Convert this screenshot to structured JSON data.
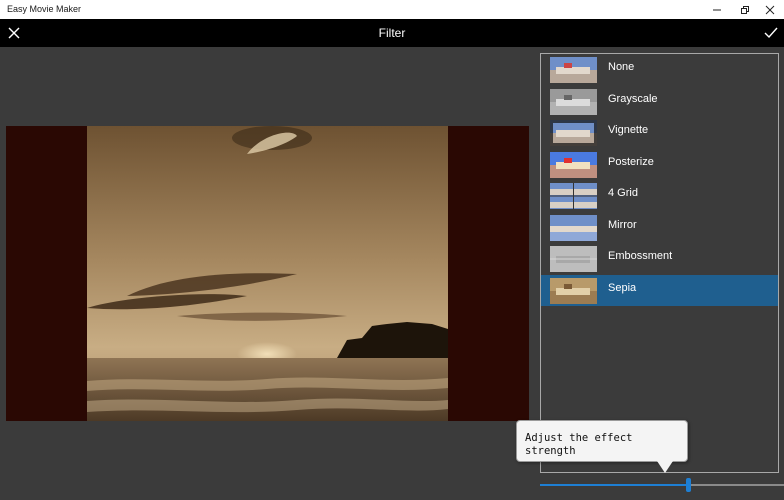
{
  "window": {
    "app_title": "Easy Movie Maker",
    "min_icon": "minimize-icon",
    "max_icon": "restore-icon",
    "close_icon": "close-icon"
  },
  "header": {
    "title": "Filter",
    "close_icon": "close-icon",
    "confirm_icon": "check-icon"
  },
  "filters": {
    "items": [
      {
        "label": "None",
        "selected": false
      },
      {
        "label": "Grayscale",
        "selected": false
      },
      {
        "label": "Vignette",
        "selected": false
      },
      {
        "label": "Posterize",
        "selected": false
      },
      {
        "label": "4 Grid",
        "selected": false
      },
      {
        "label": "Mirror",
        "selected": false
      },
      {
        "label": "Embossment",
        "selected": false
      },
      {
        "label": "Sepia",
        "selected": true
      }
    ]
  },
  "slider": {
    "value_fraction": 0.61
  },
  "tooltip": {
    "line1": "Adjust the effect",
    "line2": "strength"
  },
  "colors": {
    "accent": "#1e7fd4",
    "selected_row": "#1f5f8f",
    "background": "#3b3b3b",
    "header": "#000000"
  }
}
